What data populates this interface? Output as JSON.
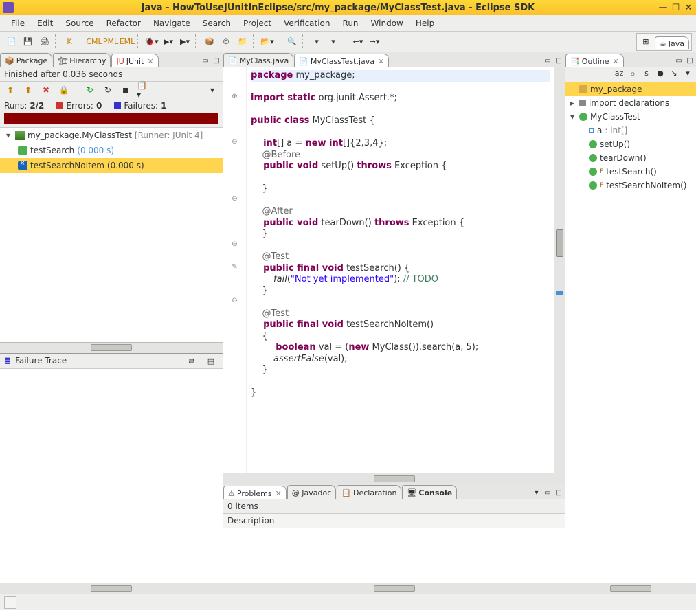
{
  "window": {
    "title": "Java - HowToUseJUnitInEclipse/src/my_package/MyClassTest.java - Eclipse SDK"
  },
  "menu": [
    "File",
    "Edit",
    "Source",
    "Refactor",
    "Navigate",
    "Search",
    "Project",
    "Verification",
    "Run",
    "Window",
    "Help"
  ],
  "perspective": "Java",
  "left_tabs": {
    "package": "Package",
    "hierarchy": "Hierarchy",
    "junit": "JUnit"
  },
  "junit": {
    "finished": "Finished after 0.036 seconds",
    "runs_label": "Runs:",
    "runs": "2/2",
    "errors_label": "Errors:",
    "errors": "0",
    "failures_label": "Failures:",
    "failures": "1",
    "suite": "my_package.MyClassTest",
    "runner": "[Runner: JUnit 4]",
    "test1": "testSearch",
    "test1_time": "(0.000 s)",
    "test2": "testSearchNoItem",
    "test2_time": "(0.000 s)",
    "failure_trace_label": "Failure Trace"
  },
  "editor_tabs": {
    "t1": "MyClass.java",
    "t2": "MyClassTest.java"
  },
  "code": {
    "l1a": "package",
    "l1b": " my_package;",
    "l2a": "import",
    "l2b": " static",
    "l2c": " org.junit.Assert.*;",
    "l3a": "public",
    "l3b": " class",
    "l3c": " MyClassTest {",
    "l4a": "    int",
    "l4b": "[] a = ",
    "l4c": "new",
    "l4d": " int",
    "l4e": "[]{2,3,4};",
    "l5": "    @Before",
    "l6a": "    public",
    "l6b": " void",
    "l6c": " setUp() ",
    "l6d": "throws",
    "l6e": " Exception {",
    "l7": "    }",
    "l8": "    @After",
    "l9a": "    public",
    "l9b": " void",
    "l9c": " tearDown() ",
    "l9d": "throws",
    "l9e": " Exception {",
    "l10": "    }",
    "l11": "    @Test",
    "l12a": "    public",
    "l12b": " final",
    "l12c": " void",
    "l12d": " testSearch() {",
    "l13a": "        fail",
    "l13b": "(",
    "l13c": "\"Not yet implemented\"",
    "l13d": "); ",
    "l13e": "// TODO",
    "l14": "    }",
    "l15": "    @Test",
    "l16a": "    public",
    "l16b": " final",
    "l16c": " void",
    "l16d": " testSearchNoItem()",
    "l17": "    {",
    "l18a": "        boolean",
    "l18b": " val = (",
    "l18c": "new",
    "l18d": " MyClass()).search(a, 5);",
    "l19a": "        assertFalse",
    "l19b": "(val);",
    "l20": "    }",
    "l21": "}"
  },
  "outline": {
    "title": "Outline",
    "pkg": "my_package",
    "imports": "import declarations",
    "cls": "MyClassTest",
    "field_name": "a",
    "field_type": ": int[]",
    "m1": "setUp()",
    "m2": "tearDown()",
    "m3": "testSearch()",
    "m4": "testSearchNoItem()"
  },
  "bottom_tabs": {
    "problems": "Problems",
    "javadoc": "@ Javadoc",
    "decl": "Declaration",
    "console": "Console"
  },
  "problems": {
    "count": "0 items",
    "col": "Description"
  }
}
